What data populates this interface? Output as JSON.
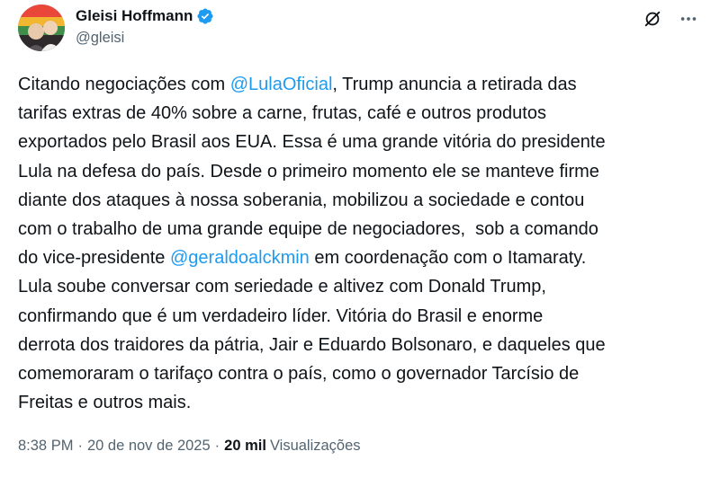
{
  "author": {
    "display_name": "Gleisi Hoffmann",
    "handle": "@gleisi",
    "verified": true
  },
  "icons": {
    "verified": "verified-badge-icon",
    "grok": "grok-icon",
    "more": "more-options-icon"
  },
  "tweet": {
    "lines": [
      {
        "parts": [
          {
            "t": "Citando negociações com "
          },
          {
            "t": "@LulaOficial",
            "mention": true
          },
          {
            "t": ", Trump anuncia a retirada das"
          }
        ]
      },
      {
        "parts": [
          {
            "t": "tarifas extras de 40% sobre a carne, frutas, café e outros produtos"
          }
        ]
      },
      {
        "parts": [
          {
            "t": "exportados pelo Brasil aos EUA. Essa é uma grande vitória do presidente"
          }
        ]
      },
      {
        "parts": [
          {
            "t": "Lula na defesa do país. Desde o primeiro momento ele se manteve firme"
          }
        ]
      },
      {
        "parts": [
          {
            "t": "diante dos ataques à nossa soberania, mobilizou a sociedade e contou"
          }
        ]
      },
      {
        "parts": [
          {
            "t": "com o trabalho de uma grande equipe de negociadores,  sob a comando"
          }
        ]
      },
      {
        "parts": [
          {
            "t": "do vice-presidente "
          },
          {
            "t": "@geraldoalckmin",
            "mention": true
          },
          {
            "t": " em coordenação com o Itamaraty."
          }
        ]
      },
      {
        "parts": [
          {
            "t": "Lula soube conversar com seriedade e altivez com Donald Trump,"
          }
        ]
      },
      {
        "parts": [
          {
            "t": "confirmando que é um verdadeiro líder. Vitória do Brasil e enorme"
          }
        ]
      },
      {
        "parts": [
          {
            "t": "derrota dos traidores da pátria, Jair e Eduardo Bolsonaro, e daqueles que"
          }
        ]
      },
      {
        "parts": [
          {
            "t": "comemoraram o tarifaço contra o país, como o governador Tarcísio de"
          }
        ]
      },
      {
        "parts": [
          {
            "t": "Freitas e outros mais."
          }
        ]
      }
    ]
  },
  "meta": {
    "time": "8:38 PM",
    "separator": "·",
    "date": "20 de nov de 2025",
    "views_count": "20 mil",
    "views_label": "Visualizações"
  },
  "colors": {
    "accent": "#1d9bf0",
    "text": "#0f1419",
    "secondary": "#536471"
  }
}
